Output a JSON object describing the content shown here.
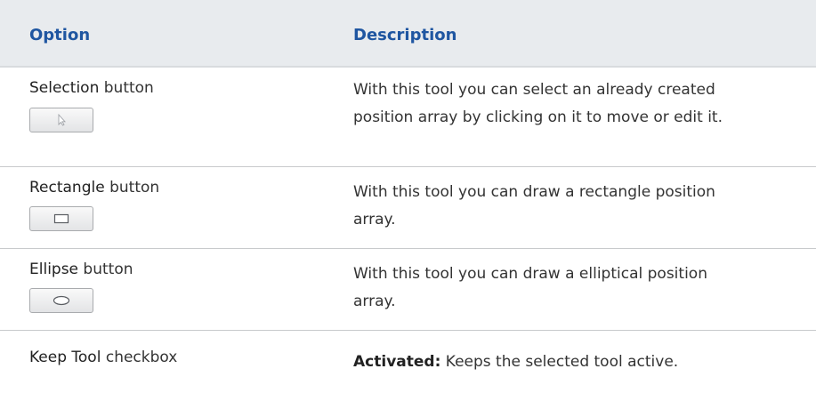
{
  "header": {
    "option": "Option",
    "description": "Description"
  },
  "rows": [
    {
      "term": "Selection",
      "suffix": " button",
      "icon": "cursor-arrow-icon",
      "description": "With this tool you can select an already created position array by clicking on it to move or edit it."
    },
    {
      "term": "Rectangle",
      "suffix": " button",
      "icon": "rectangle-icon",
      "description": "With this tool you can draw a rectangle position array."
    },
    {
      "term": "Ellipse",
      "suffix": " button",
      "icon": "ellipse-icon",
      "description": "With this tool you can draw a elliptical position array."
    },
    {
      "term": "Keep Tool",
      "suffix": " checkbox",
      "description_bold": "Activated:",
      "description": " Keeps the selected tool active."
    }
  ],
  "colors": {
    "header_text": "#1f56a1",
    "header_bg": "#e8ebee"
  }
}
